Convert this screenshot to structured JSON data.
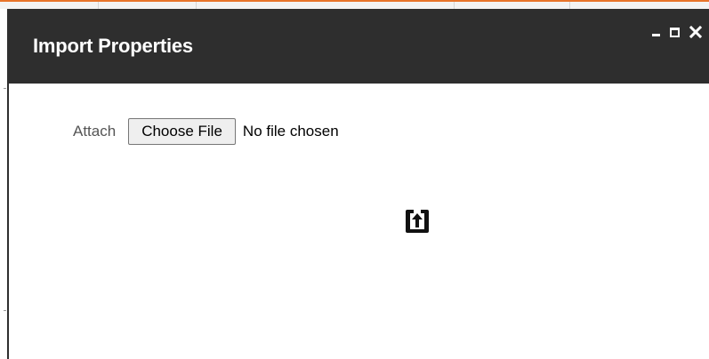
{
  "dialog": {
    "title": "Import Properties",
    "controls": {
      "minimize_icon": "minimize-icon",
      "maximize_icon": "maximize-icon",
      "close_icon": "close-icon"
    }
  },
  "form": {
    "attach_label": "Attach",
    "choose_file_label": "Choose File",
    "file_status": "No file chosen",
    "upload_icon": "upload-icon"
  },
  "colors": {
    "titlebar": "#2e2e2e",
    "title_text": "#ffffff",
    "accent": "#e8742a"
  }
}
